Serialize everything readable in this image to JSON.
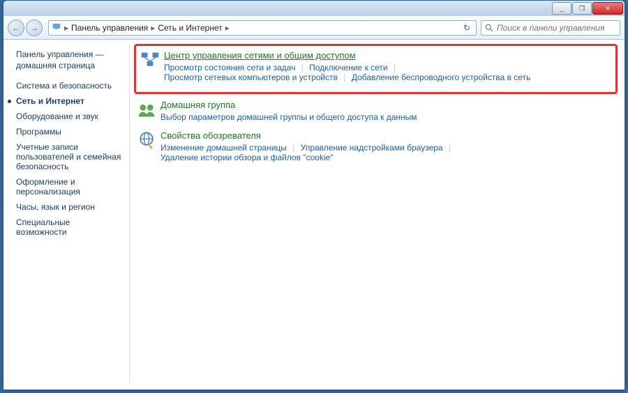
{
  "titlebar": {
    "min": "_",
    "max": "❐",
    "close": "✕"
  },
  "breadcrumb": {
    "root": "Панель управления",
    "current": "Сеть и Интернет"
  },
  "search": {
    "placeholder": "Поиск в панели управления"
  },
  "sidebar": {
    "home": "Панель управления — домашняя страница",
    "items": [
      {
        "label": "Система и безопасность",
        "selected": false
      },
      {
        "label": "Сеть и Интернет",
        "selected": true
      },
      {
        "label": "Оборудование и звук",
        "selected": false
      },
      {
        "label": "Программы",
        "selected": false
      },
      {
        "label": "Учетные записи пользователей и семейная безопасность",
        "selected": false
      },
      {
        "label": "Оформление и персонализация",
        "selected": false
      },
      {
        "label": "Часы, язык и регион",
        "selected": false
      },
      {
        "label": "Специальные возможности",
        "selected": false
      }
    ]
  },
  "sections": {
    "network": {
      "title": "Центр управления сетями и общим доступом",
      "links": {
        "a": "Просмотр состояния сети и задач",
        "b": "Подключение к сети",
        "c": "Просмотр сетевых компьютеров и устройств",
        "d": "Добавление беспроводного устройства в сеть"
      }
    },
    "homegroup": {
      "title": "Домашняя группа",
      "links": {
        "a": "Выбор параметров домашней группы и общего доступа к данным"
      }
    },
    "internet": {
      "title": "Свойства обозревателя",
      "links": {
        "a": "Изменение домашней страницы",
        "b": "Управление надстройками браузера",
        "c": "Удаление истории обзора и файлов \"cookie\""
      }
    }
  }
}
